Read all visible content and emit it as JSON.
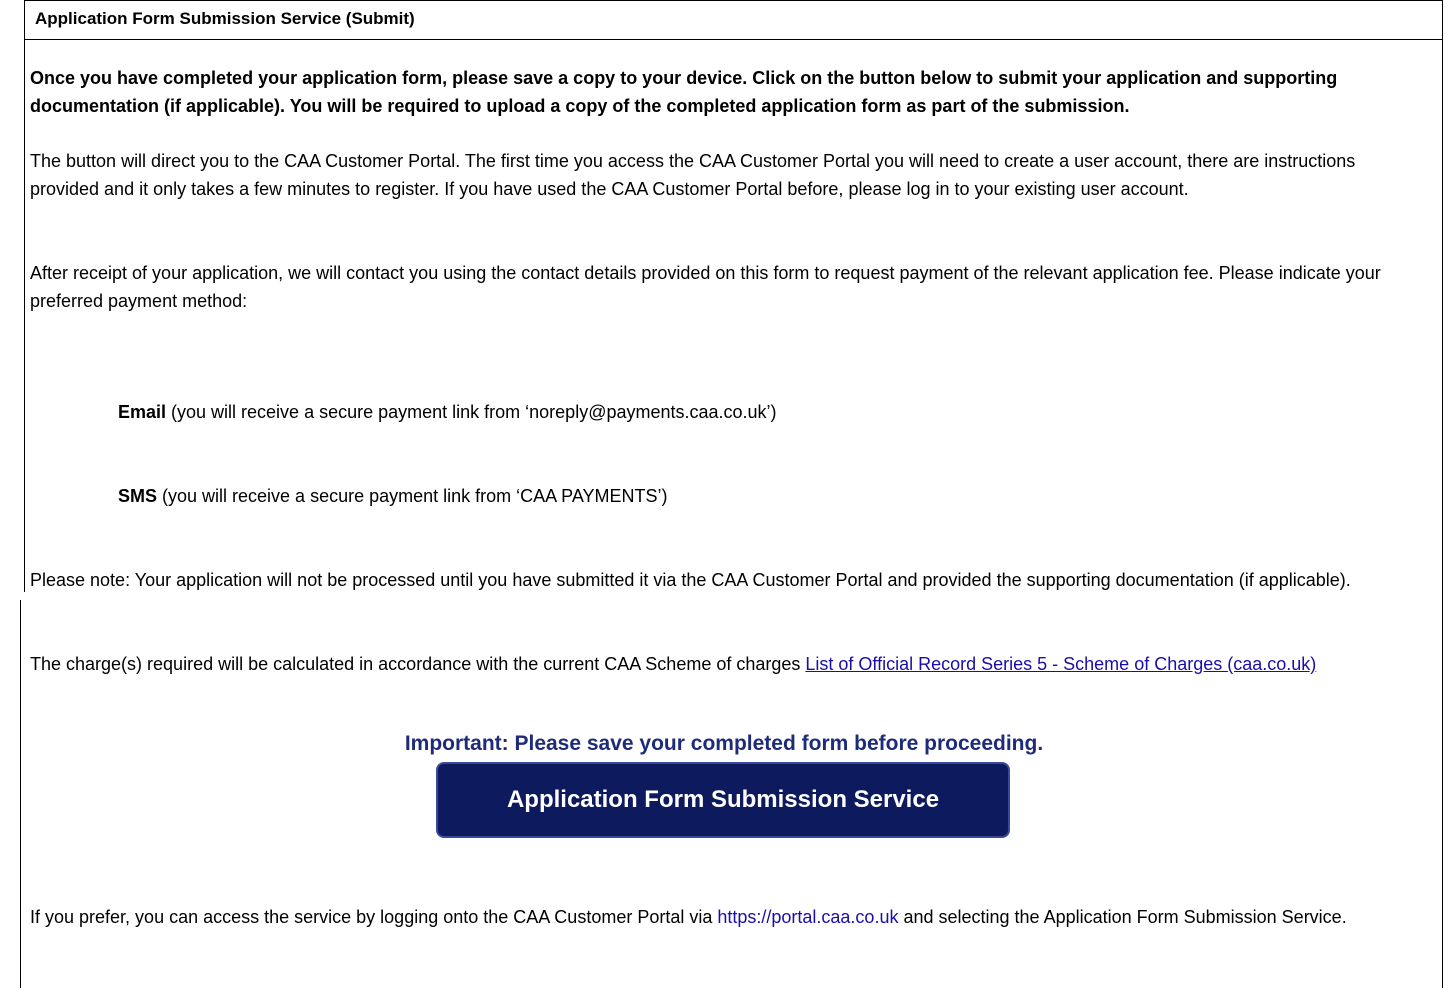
{
  "header": {
    "title": "Application Form Submission Service (Submit)"
  },
  "intro_bold": "Once you have completed your application form, please save a copy to your device. Click on the button below to submit your application and supporting documentation (if applicable). You will be required to upload a copy of the completed application form as part of the submission.",
  "portal_info": "The button will direct you to the CAA Customer Portal. The first time you access the CAA Customer Portal you will need to create a user account, there are instructions provided and it only takes a few minutes to register.  If you have used the CAA Customer Portal before, please log in to your existing user account.",
  "payment_intro": "After receipt of your application, we will contact you using the contact details provided on this form to request payment of the relevant application fee.  Please indicate your preferred payment method:",
  "payment_options": {
    "email_label": "Email",
    "email_desc": " (you will receive a secure payment link from ‘noreply@payments.caa.co.uk’)",
    "sms_label": "SMS",
    "sms_desc": " (you will receive a secure payment link from ‘CAA PAYMENTS’)"
  },
  "note": "Please note: Your application will not be processed until you have submitted it via the CAA Customer Portal and provided the supporting documentation (if applicable).",
  "charges": {
    "text": "The charge(s) required will be calculated in accordance with the current CAA Scheme of charges ",
    "link_text": "List of Official Record Series 5 - Scheme of Charges (caa.co.uk)"
  },
  "important": "Important: Please save your completed form before proceeding.",
  "submit_button": "Application Form Submission Service",
  "alternative": {
    "text_before": "If you prefer, you can access the service by logging onto the CAA Customer Portal via ",
    "link": "https://portal.caa.co.uk",
    "text_after": " and selecting the Application Form Submission Service."
  }
}
